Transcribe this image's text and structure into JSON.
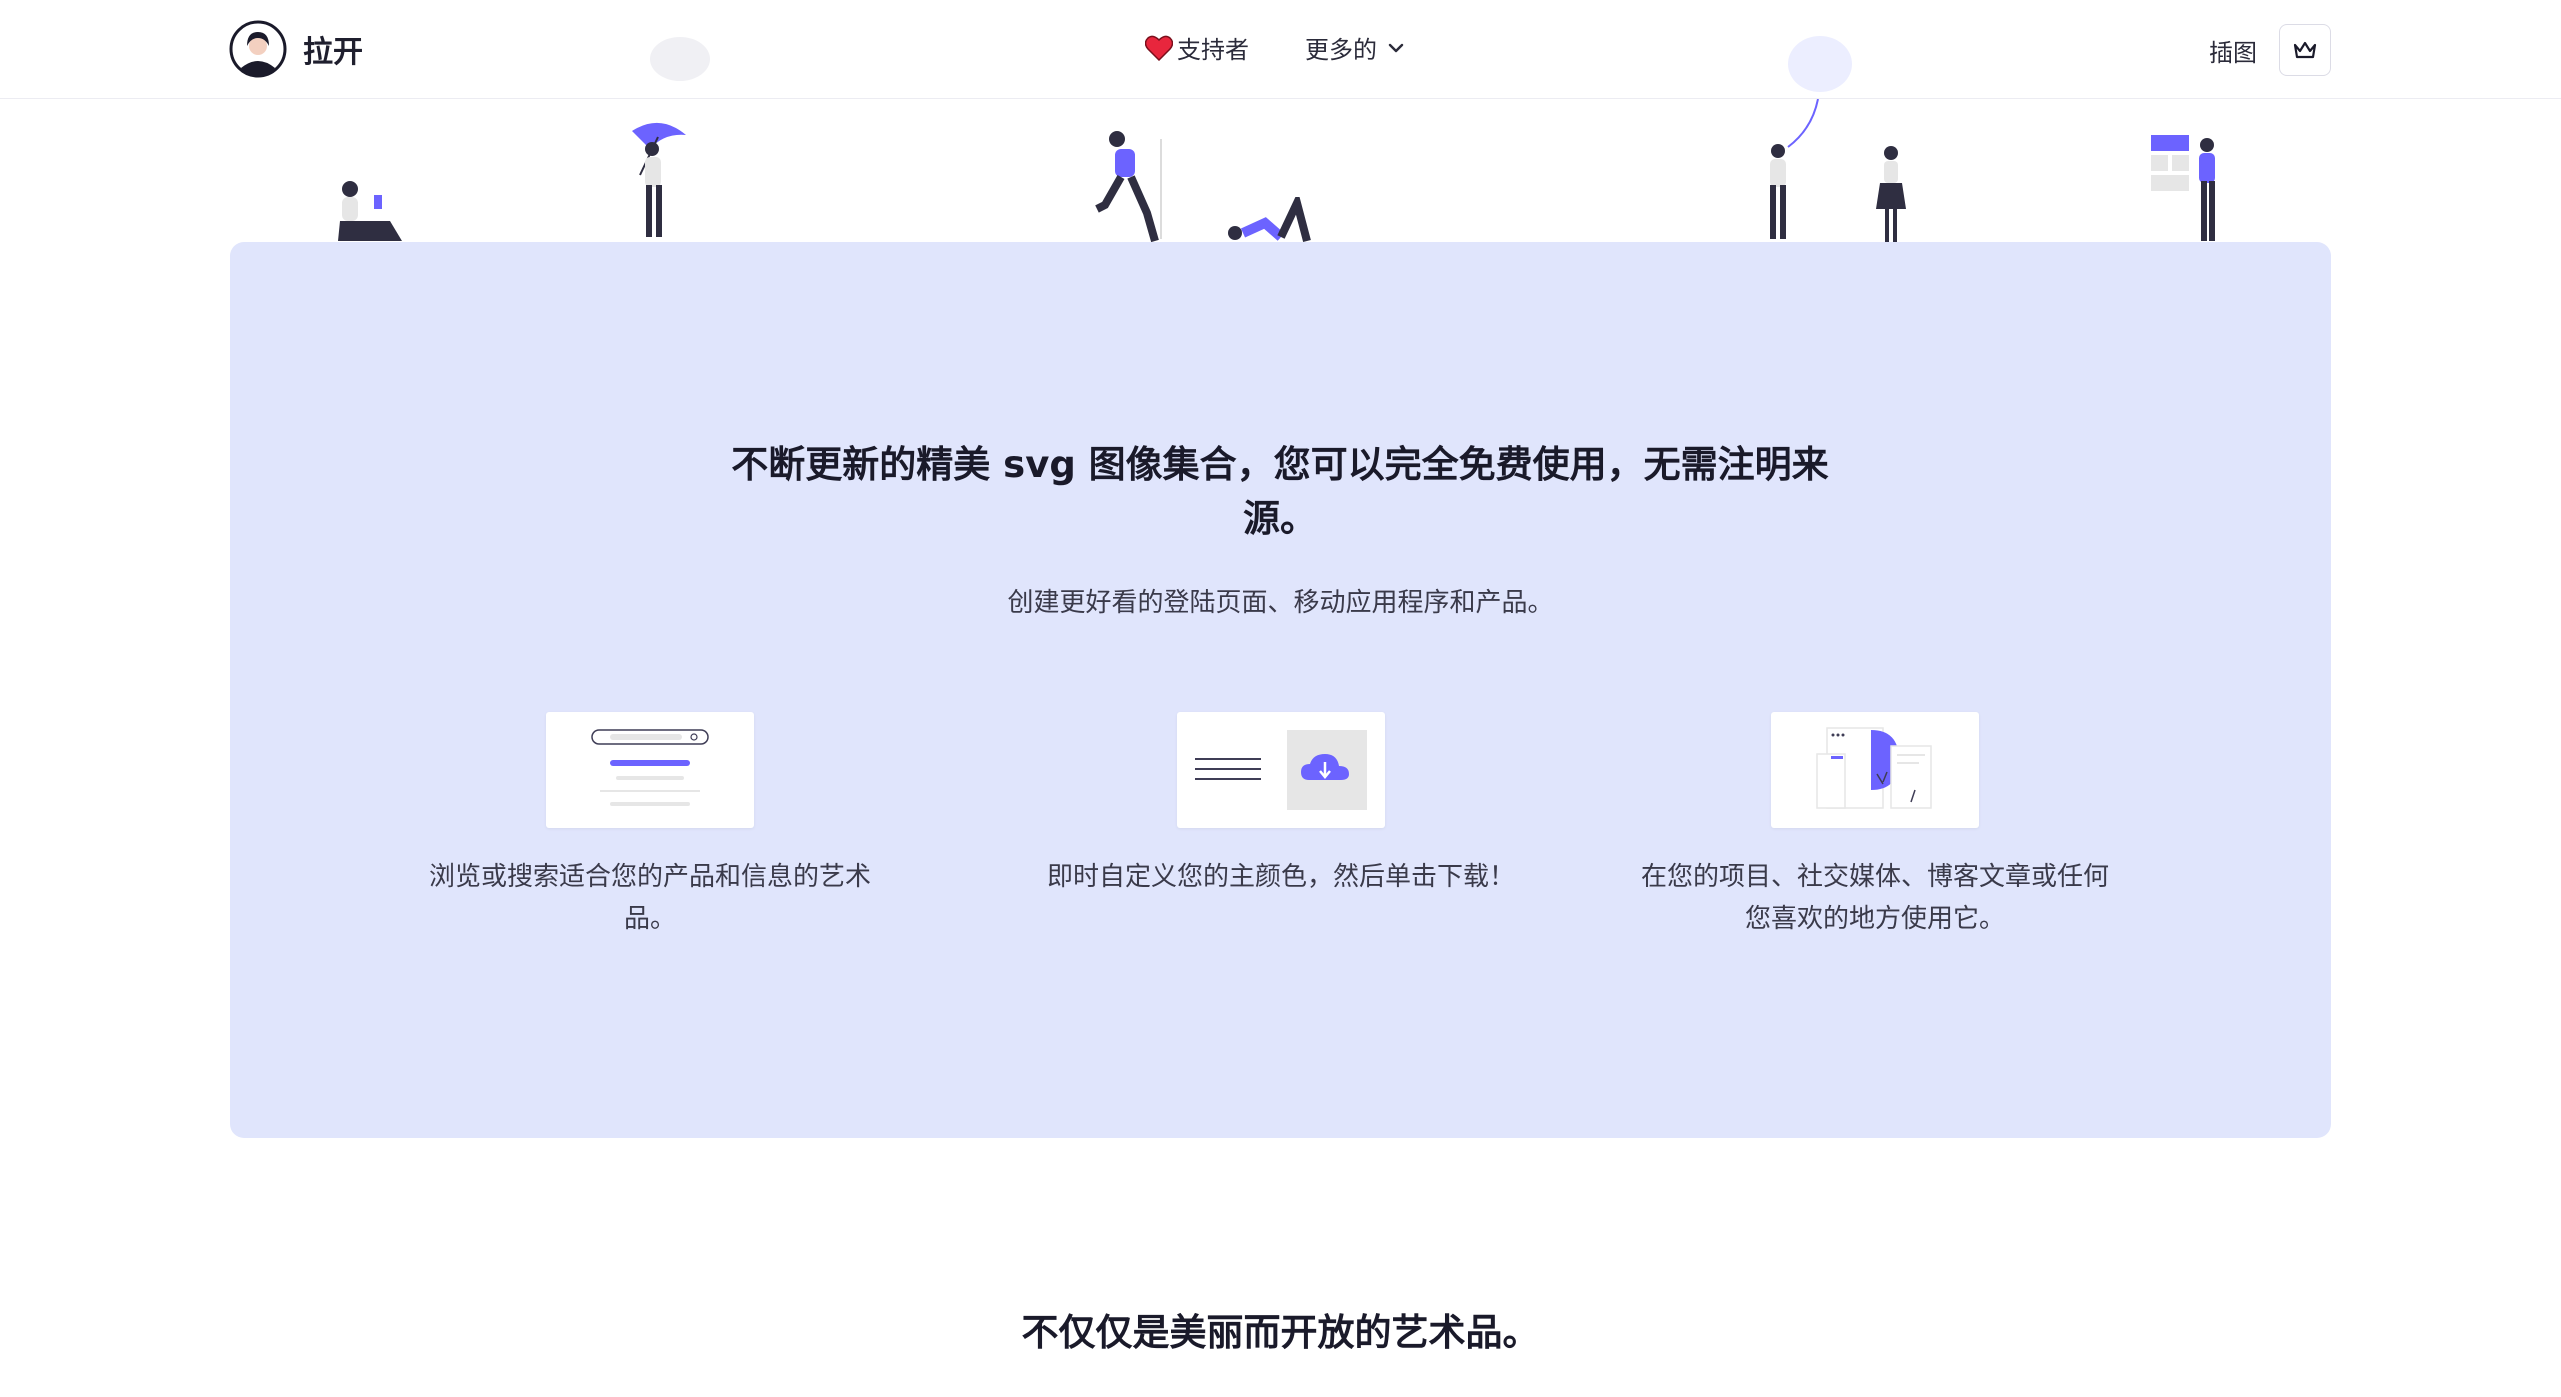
{
  "header": {
    "brand": "拉开",
    "nav": {
      "supporters": "支持者",
      "more": "更多的"
    },
    "illustrations_link": "插图"
  },
  "hero": {
    "title": "不断更新的精美 svg 图像集合，您可以完全免费使用，无需注明来源。",
    "subtitle": "创建更好看的登陆页面、移动应用程序和产品。",
    "features": [
      {
        "text": "浏览或搜索适合您的产品和信息的艺术品。"
      },
      {
        "text": "即时自定义您的主颜色，然后单击下载！"
      },
      {
        "text": "在您的项目、社交媒体、博客文章或任何您喜欢的地方使用它。"
      }
    ]
  },
  "section2": {
    "title": "不仅仅是美丽而开放的艺术品。"
  },
  "colors": {
    "accent": "#6c63ff",
    "hero_bg": "#e0e5fc",
    "heart": "#e8263d"
  }
}
